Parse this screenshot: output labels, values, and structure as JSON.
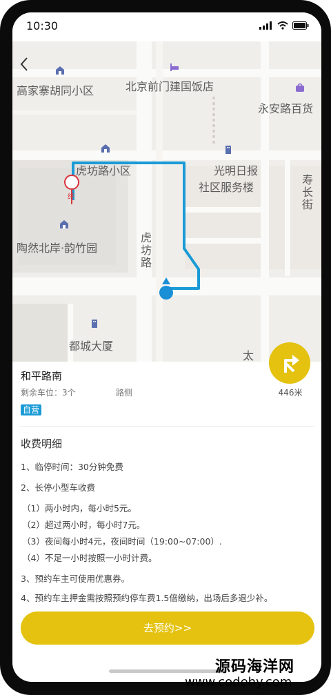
{
  "status_bar": {
    "time": "10:30"
  },
  "map": {
    "labels": {
      "l1": "高家寨胡同小区",
      "l2": "北京前门建国饭店",
      "l3": "永安路百货",
      "l4": "虎坊路小区",
      "l5": "光明日报",
      "l6": "社区服务楼",
      "l7": "寿长街",
      "l8": "陶然北岸·韵竹园",
      "l9": "虎坊路",
      "l10": "都城大厦",
      "l11": "太",
      "end_marker": "终"
    }
  },
  "parking": {
    "name": "和平路南",
    "spaces": "剩余车位：3个",
    "location_type": "路侧",
    "badge": "自营",
    "distance": "446米"
  },
  "fees": {
    "title": "收费明细",
    "rules": [
      "1、临停时间：30分钟免费",
      "2、长停小型车收费",
      "（1）两小时内，每小时5元。",
      "（2）超过两小时，每小时7元。",
      "（3）夜间每小时4元，夜间时间（19:00~07:00）.",
      "（4）不足一小时按照一小时计费。",
      "3、预约车主可使用优惠券。",
      "4、预约车主押金需按照预约停车费1.5倍缴纳，出场后多退少补。"
    ]
  },
  "reserve_button": "去预约>>",
  "watermark": {
    "line1": "源码海洋网",
    "line2": "www.codehy.com"
  },
  "colors": {
    "accent": "#e4c20f",
    "route": "#1a9bd6",
    "badge": "#1a9bd6"
  }
}
